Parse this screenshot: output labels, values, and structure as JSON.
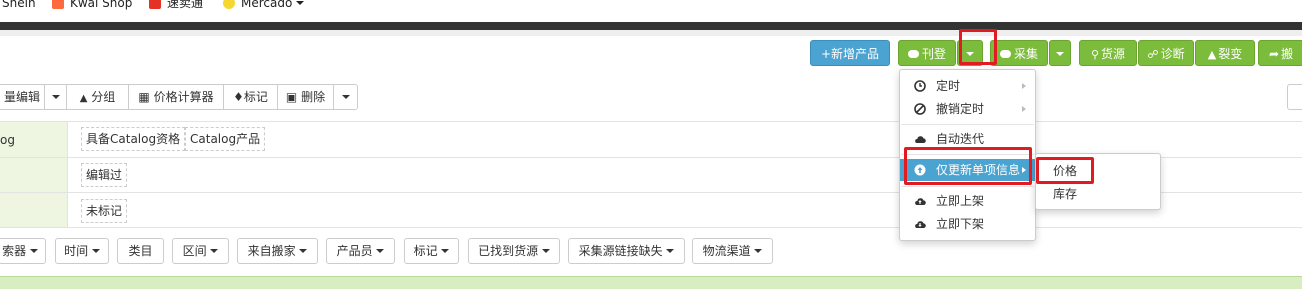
{
  "bookmarks": [
    {
      "label": "Shein",
      "icon": "shein-icon"
    },
    {
      "label": "Kwai Shop",
      "icon": "kwai-icon"
    },
    {
      "label": "速卖通",
      "icon": "aliexpress-icon"
    },
    {
      "label": "Mercado",
      "icon": "mercado-icon"
    }
  ],
  "toolbar": {
    "add_product": "+新增产品",
    "publish": "刊登",
    "collect": "采集",
    "source": "货源",
    "diagnose": "诊断",
    "variant": "裂变",
    "move": "搬"
  },
  "secondary_toolbar": {
    "batch_edit": "量编辑",
    "group": "分组",
    "price_calc": "价格计算器",
    "mark": "标记",
    "delete": "删除"
  },
  "filters": {
    "catalog_label": "og",
    "catalog_options": [
      "具备Catalog资格",
      "Catalog产品"
    ],
    "edited_option": "编辑过",
    "unmarked_option": "未标记"
  },
  "filter_buttons": [
    "索器",
    "时间",
    "类目",
    "区间",
    "来自搬家",
    "产品员",
    "标记",
    "已找到货源",
    "采集源链接缺失",
    "物流渠道"
  ],
  "publish_menu": {
    "items": [
      {
        "label": "定时",
        "icon": "clock-icon",
        "has_submenu": true
      },
      {
        "label": "撤销定时",
        "icon": "ban-icon",
        "has_submenu": true
      },
      {
        "label": "自动迭代",
        "icon": "cloud-icon",
        "has_submenu": false
      },
      {
        "label": "仅更新单项信息",
        "icon": "up-circle-icon",
        "has_submenu": true
      },
      {
        "label": "立即上架",
        "icon": "cloud-upload-icon",
        "has_submenu": false
      },
      {
        "label": "立即下架",
        "icon": "cloud-download-icon",
        "has_submenu": false
      }
    ],
    "submenu": [
      "价格",
      "库存"
    ]
  },
  "colors": {
    "green": "#7cbc3c",
    "blue": "#4aa3d0",
    "highlight_red": "#e11b22",
    "filter_label_bg": "#eef6e2"
  }
}
